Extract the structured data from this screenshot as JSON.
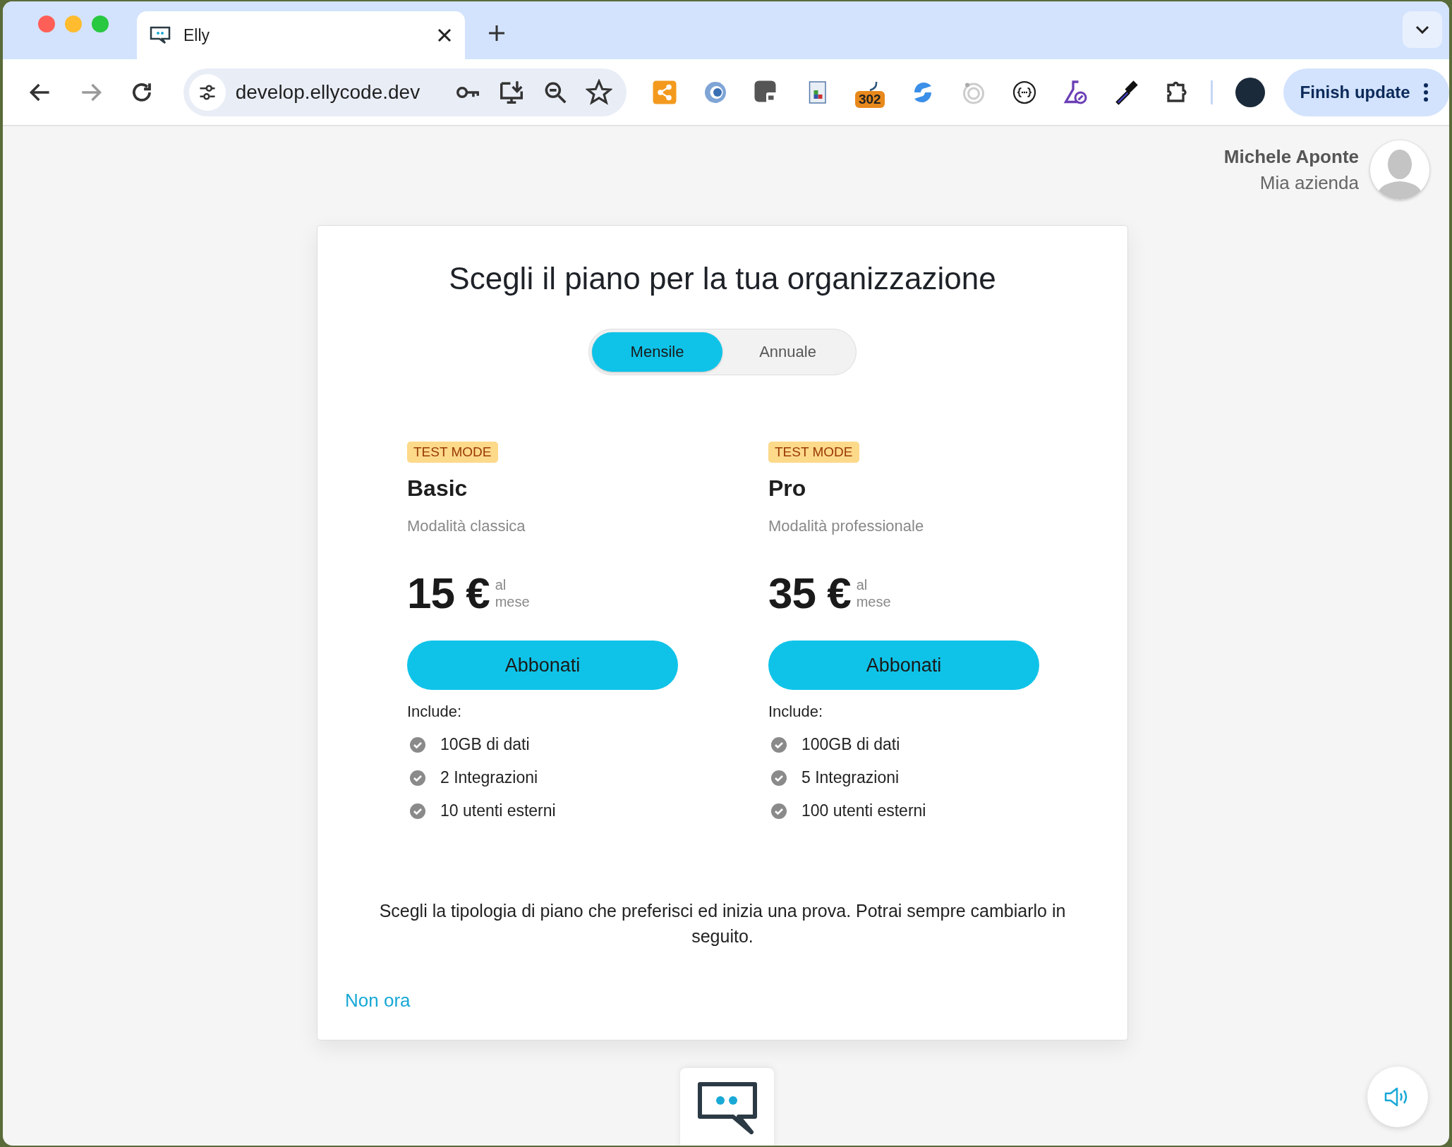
{
  "browser": {
    "tab_title": "Elly",
    "address": "develop.ellycode.dev",
    "extension_badge": "302",
    "update_button": "Finish update"
  },
  "user": {
    "name": "Michele Aponte",
    "company": "Mia azienda"
  },
  "dialog": {
    "title": "Scegli il piano per la tua organizzazione",
    "billing_toggle": [
      {
        "label": "Mensile",
        "selected": true
      },
      {
        "label": "Annuale",
        "selected": false
      }
    ],
    "plans": [
      {
        "badge": "TEST MODE",
        "name": "Basic",
        "subtitle": "Modalità classica",
        "price": "15 €",
        "period_top": "al",
        "period_bottom": "mese",
        "button": "Abbonati",
        "includes_label": "Include:",
        "features": [
          "10GB di dati",
          "2 Integrazioni",
          "10 utenti esterni"
        ]
      },
      {
        "badge": "TEST MODE",
        "name": "Pro",
        "subtitle": "Modalità professionale",
        "price": "35 €",
        "period_top": "al",
        "period_bottom": "mese",
        "button": "Abbonati",
        "includes_label": "Include:",
        "features": [
          "100GB di dati",
          "5 Integrazioni",
          "100 utenti esterni"
        ]
      }
    ],
    "note": "Scegli la tipologia di piano che preferisci ed inizia una prova. Potrai sempre cambiarlo in seguito.",
    "skip_link": "Non ora"
  }
}
